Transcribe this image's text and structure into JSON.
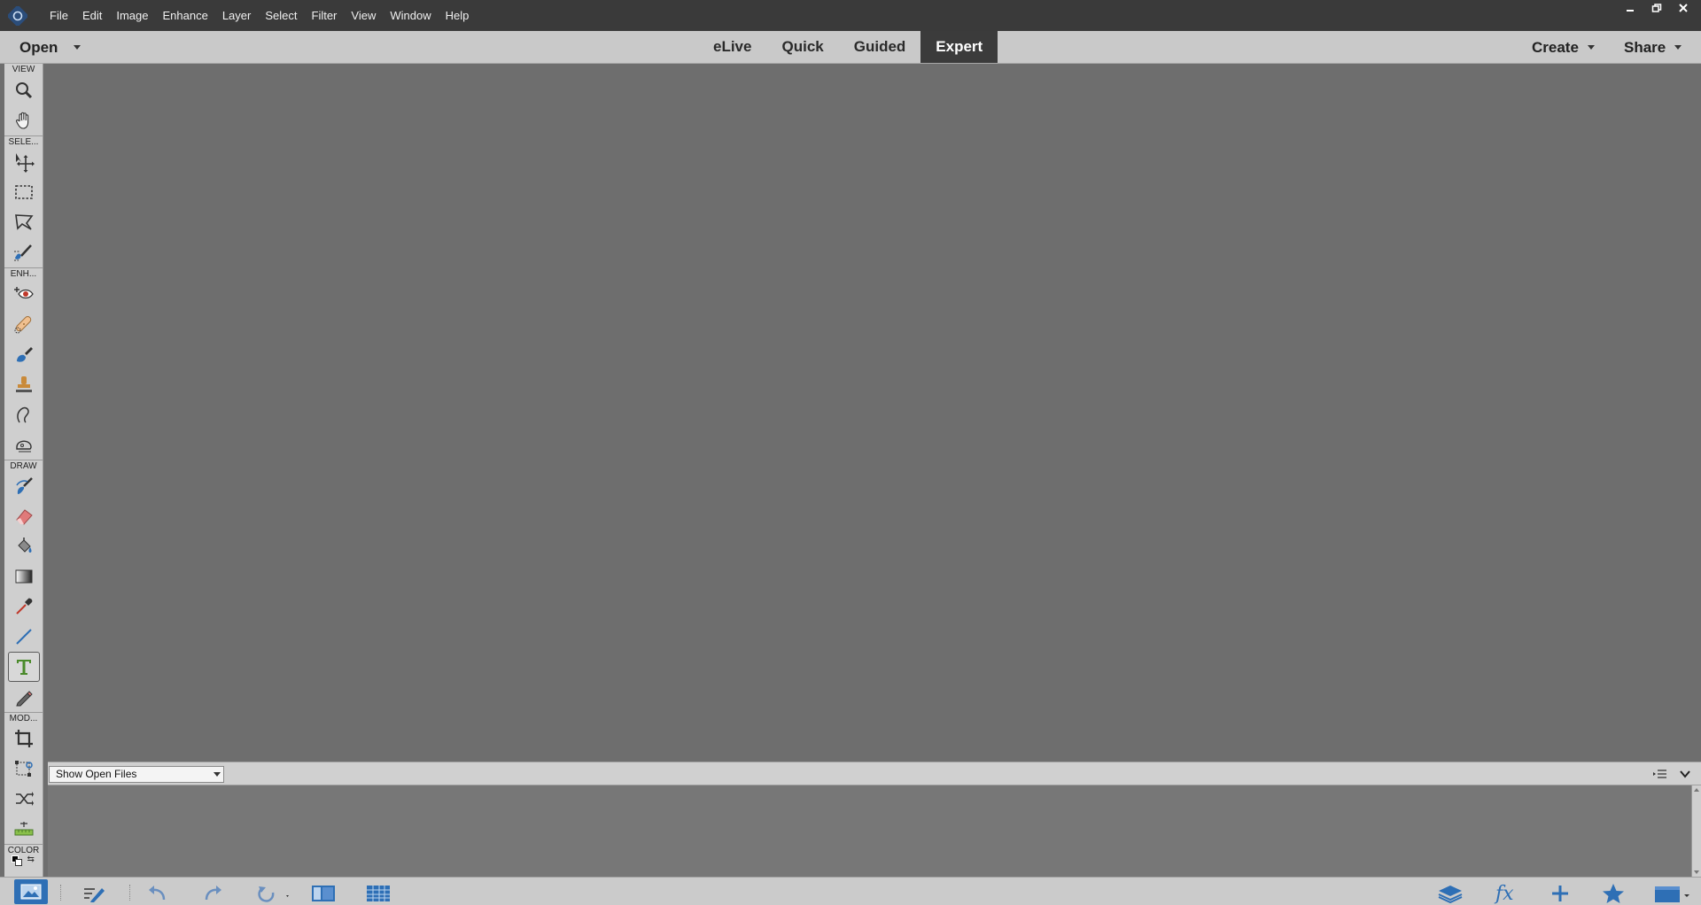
{
  "menu": {
    "items": [
      "File",
      "Edit",
      "Image",
      "Enhance",
      "Layer",
      "Select",
      "Filter",
      "View",
      "Window",
      "Help"
    ]
  },
  "window_controls": [
    "minimize-icon",
    "restore-icon",
    "close-icon"
  ],
  "modebar": {
    "open_label": "Open",
    "tabs": [
      "eLive",
      "Quick",
      "Guided",
      "Expert"
    ],
    "active_tab": "Expert",
    "create_label": "Create",
    "share_label": "Share"
  },
  "toolbox": {
    "sections": [
      "VIEW",
      "SELE...",
      "ENH...",
      "DRAW",
      "MOD...",
      "COLOR"
    ],
    "tools": [
      "zoom-icon",
      "hand-icon",
      "move-icon",
      "marquee-icon",
      "lasso-icon",
      "quick-selection-icon",
      "red-eye-icon",
      "spot-healing-icon",
      "smart-brush-icon",
      "clone-stamp-icon",
      "blur-icon",
      "sponge-icon",
      "brush-icon",
      "eraser-icon",
      "paint-bucket-icon",
      "gradient-icon",
      "eyedropper-icon",
      "line-icon",
      "type-icon",
      "pencil-icon",
      "crop-icon",
      "recompose-icon",
      "content-aware-move-icon",
      "straighten-icon"
    ],
    "active_tool": "type-icon"
  },
  "photo_bin": {
    "select_value": "Show Open Files"
  },
  "taskbar": {
    "icons": [
      "photo-bin-icon",
      "tool-options-icon",
      "undo-icon",
      "redo-icon",
      "rotate-icon",
      "layout-icon",
      "organizer-icon",
      "layers-icon",
      "effects-icon",
      "add-icon",
      "favorites-icon",
      "more-icon"
    ]
  },
  "colors": {
    "titlebar": "#3a3a3a",
    "modebar": "#c9c9c9",
    "canvas": "#6e6e6e",
    "active_tab": "#3b3b3b",
    "accent_blue": "#2e6fb5"
  }
}
